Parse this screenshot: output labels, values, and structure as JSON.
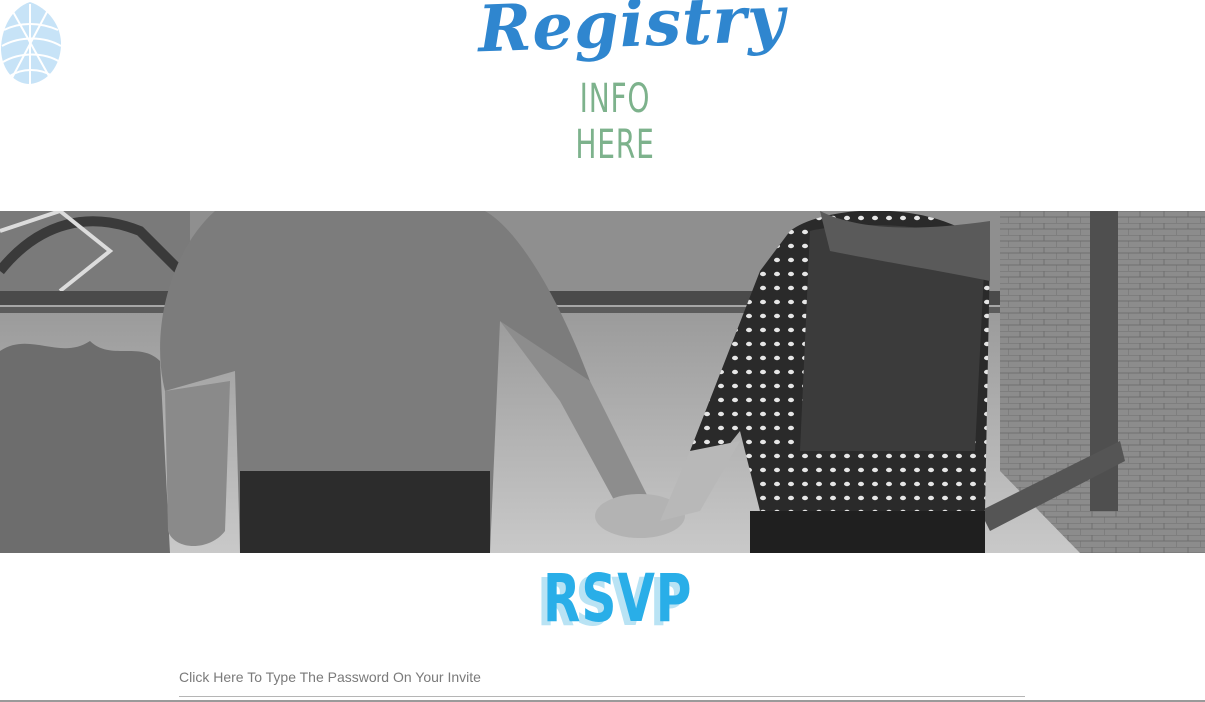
{
  "header": {
    "title": "Registry",
    "subtitle_line1": "INFO",
    "subtitle_line2": "HERE"
  },
  "rsvp": {
    "title": "RSVP"
  },
  "password": {
    "placeholder": "Click Here To Type The Password On Your Invite",
    "value": ""
  },
  "colors": {
    "registry_blue": "#2f86cf",
    "info_green": "#7db28c",
    "rsvp_blue": "#29aee8",
    "pinecone": "#bfe0f6"
  },
  "icons": {
    "logo": "pinecone-icon"
  }
}
